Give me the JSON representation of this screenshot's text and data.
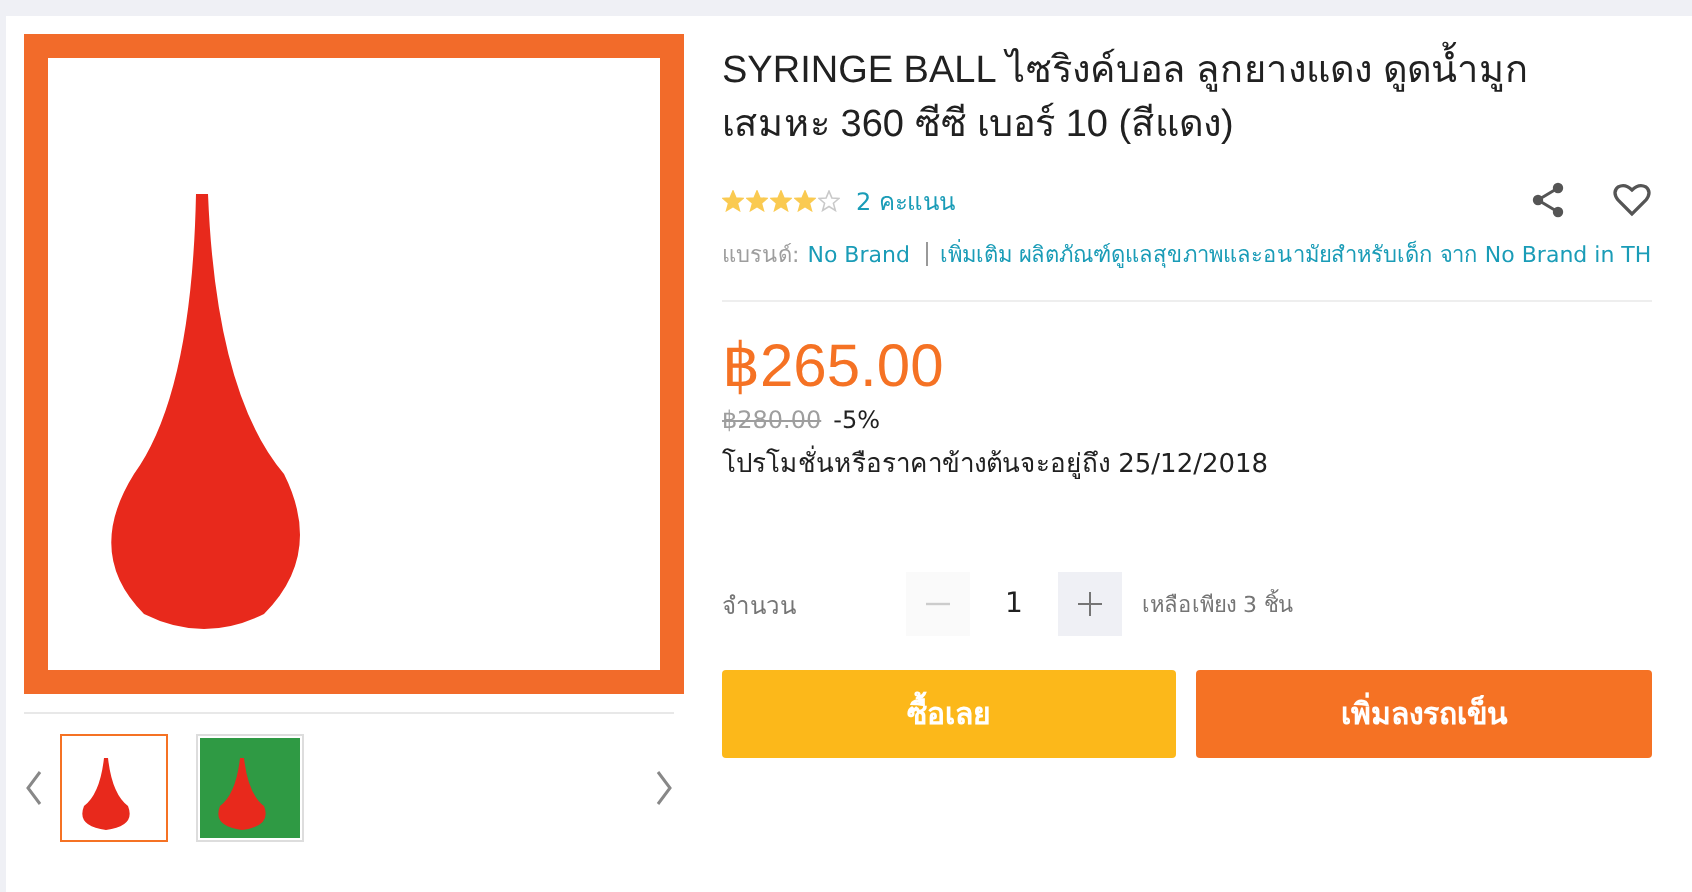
{
  "gallery": {
    "thumbnails": [
      {
        "selected": true
      },
      {
        "selected": false
      }
    ]
  },
  "product": {
    "title": "SYRINGE BALL ไซริงค์บอล ลูกยางแดง ดูดน้ำมูก เสมหะ 360 ซีซี เบอร์ 10 (สีแดง)",
    "rating": {
      "stars": 4,
      "count": "2 คะแนน"
    },
    "brand_label": "แบรนด์:",
    "brand": "No Brand",
    "more_link": "เพิ่มเติม ผลิตภัณฑ์ดูแลสุขภาพและอนามัยสำหรับเด็ก จาก No Brand in TH"
  },
  "price": {
    "current": "฿265.00",
    "original": "฿280.00",
    "discount": "-5%",
    "promo_note": "โปรโมชั่นหรือราคาข้างต้นจะอยู่ถึง 25/12/2018"
  },
  "quantity": {
    "label": "จำนวน",
    "value": "1",
    "minus_disabled": true,
    "stock_note": "เหลือเพียง 3 ชิ้น"
  },
  "buttons": [
    {
      "kind": "buy",
      "label": "ซื้อเลย"
    },
    {
      "kind": "cart",
      "label": "เพิ่มลงรถเข็น"
    }
  ]
}
